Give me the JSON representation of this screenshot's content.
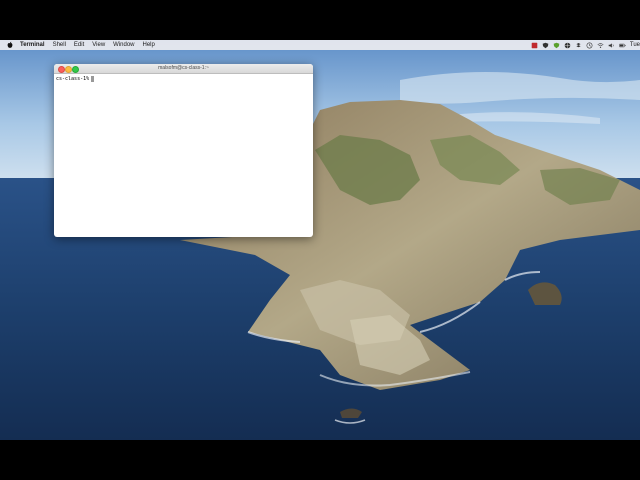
{
  "menubar": {
    "app_name": "Terminal",
    "items": [
      "Shell",
      "Edit",
      "View",
      "Window",
      "Help"
    ],
    "clock": "Tue"
  },
  "terminal_window": {
    "title": "malsofm@cs-class-1:~",
    "prompt": "cs-class-1%"
  },
  "colors": {
    "sky": "#8fb7dc",
    "sea": "#1d3d66",
    "rock": "#a79f86",
    "vegetation": "#6d7f4a"
  }
}
